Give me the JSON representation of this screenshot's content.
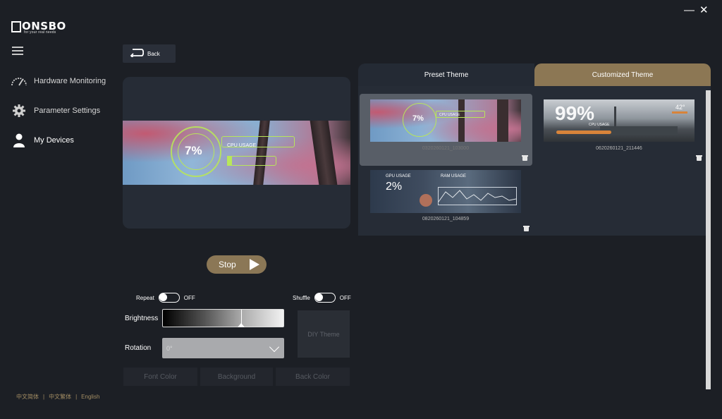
{
  "window": {
    "close_glyph": "✕",
    "minimize_glyph": "—"
  },
  "brand": {
    "logo_text": "ONSBO",
    "tagline": "for your real needs"
  },
  "sidebar": {
    "items": [
      {
        "label": "Hardware Monitoring",
        "icon": "speedometer-icon"
      },
      {
        "label": "Parameter Settings",
        "icon": "gear-icon"
      },
      {
        "label": "My Devices",
        "icon": "user-icon"
      }
    ],
    "languages": [
      "中文简体",
      "中文繁体",
      "English"
    ],
    "separator": "|"
  },
  "back": {
    "label": "Back"
  },
  "preview": {
    "value": "7%",
    "label": "CPU USAGE"
  },
  "controls": {
    "stop_label": "Stop",
    "repeat_label": "Repeat",
    "repeat_state": "OFF",
    "shuffle_label": "Shuffle",
    "shuffle_state": "OFF",
    "brightness_label": "Brightness",
    "brightness_level": 0.65,
    "rotation_label": "Rotation",
    "rotation_value": "0°",
    "diy_label": "DIY Theme",
    "font_color_label": "Font Color",
    "background_label": "Background",
    "back_color_label": "Back Color"
  },
  "themes": {
    "tabs": [
      "Preset Theme",
      "Customized Theme"
    ],
    "active_tab": "Customized Theme",
    "items": [
      {
        "name": "0320260121_103000",
        "value": "7%",
        "label": "CPU USAGE",
        "selected": true
      },
      {
        "name": "0620260121_211446",
        "value": "99%",
        "label": "CPU USAGE",
        "extra": "42°"
      },
      {
        "name": "0820260121_104859",
        "value": "2%",
        "label": "GPU USAGE",
        "extra": "RAM USAGE"
      }
    ]
  },
  "colors": {
    "accent": "#8c7754",
    "bg": "#1c1f25",
    "panel": "#262c36"
  }
}
